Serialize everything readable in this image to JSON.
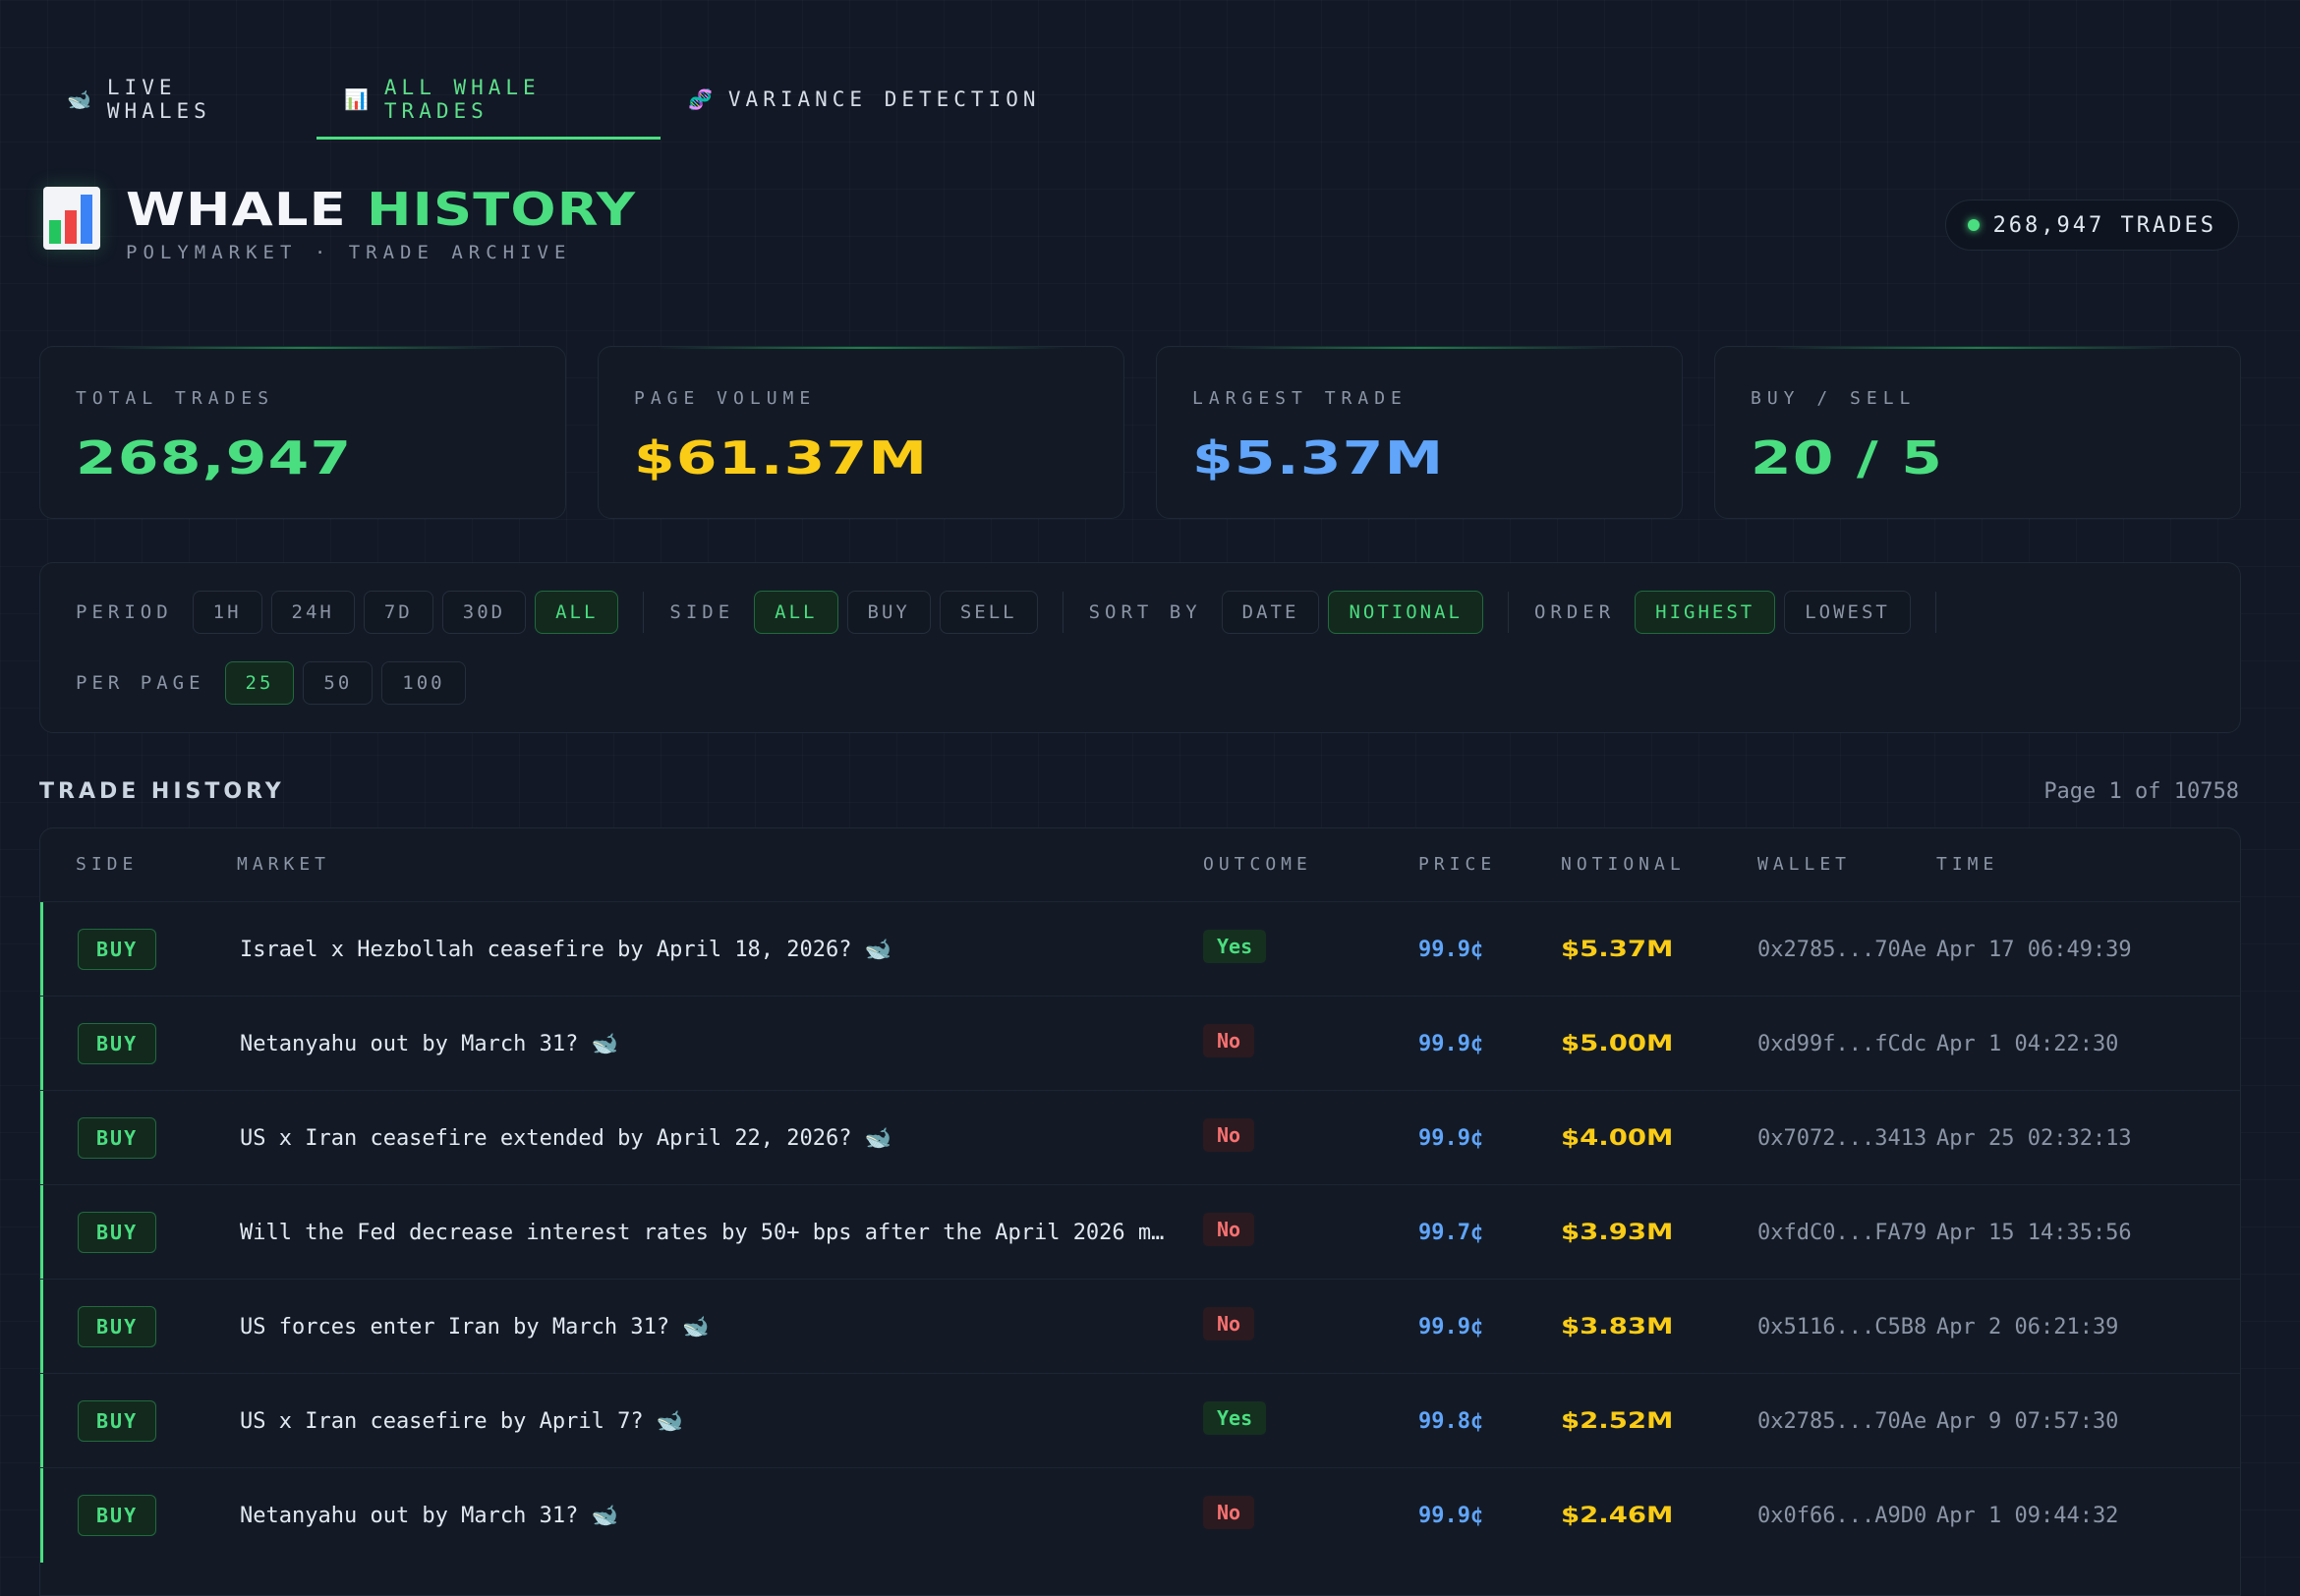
{
  "tabs": [
    {
      "icon": "🐋",
      "label": "LIVE WHALES",
      "active": false
    },
    {
      "icon": "📊",
      "label": "ALL WHALE TRADES",
      "active": true
    },
    {
      "icon": "🧬",
      "label": "VARIANCE DETECTION",
      "active": false
    }
  ],
  "header": {
    "title_white": "WHALE",
    "title_green": "HISTORY",
    "subtitle": "POLYMARKET · TRADE ARCHIVE",
    "trades_pill": "268,947 TRADES"
  },
  "stats": [
    {
      "label": "TOTAL TRADES",
      "value": "268,947",
      "color": "#4ade80"
    },
    {
      "label": "PAGE VOLUME",
      "value": "$61.37M",
      "color": "#facc15"
    },
    {
      "label": "LARGEST TRADE",
      "value": "$5.37M",
      "color": "#60a5fa"
    },
    {
      "label": "BUY / SELL",
      "value": "20 / 5",
      "color": "#4ade80"
    }
  ],
  "filters": {
    "period": {
      "label": "PERIOD",
      "options": [
        "1H",
        "24H",
        "7D",
        "30D",
        "ALL"
      ],
      "selected": "ALL"
    },
    "side": {
      "label": "SIDE",
      "options": [
        "ALL",
        "BUY",
        "SELL"
      ],
      "selected": "ALL"
    },
    "sort": {
      "label": "SORT BY",
      "options": [
        "DATE",
        "NOTIONAL"
      ],
      "selected": "NOTIONAL"
    },
    "order": {
      "label": "ORDER",
      "options": [
        "HIGHEST",
        "LOWEST"
      ],
      "selected": "HIGHEST"
    },
    "per_page": {
      "label": "PER PAGE",
      "options": [
        "25",
        "50",
        "100"
      ],
      "selected": "25"
    }
  },
  "table": {
    "title": "TRADE HISTORY",
    "page_info": "Page 1 of 10758",
    "columns": [
      "SIDE",
      "MARKET",
      "OUTCOME",
      "PRICE",
      "NOTIONAL",
      "WALLET",
      "TIME"
    ],
    "rows": [
      {
        "side": "BUY",
        "market": "Israel x Hezbollah ceasefire by April 18, 2026? 🐋",
        "outcome": "Yes",
        "price": "99.9¢",
        "notional": "$5.37M",
        "wallet": "0x2785...70Ae",
        "time": "Apr 17 06:49:39"
      },
      {
        "side": "BUY",
        "market": "Netanyahu out by March 31? 🐋",
        "outcome": "No",
        "price": "99.9¢",
        "notional": "$5.00M",
        "wallet": "0xd99f...fCdc",
        "time": "Apr 1 04:22:30"
      },
      {
        "side": "BUY",
        "market": "US x Iran ceasefire extended by April 22, 2026? 🐋",
        "outcome": "No",
        "price": "99.9¢",
        "notional": "$4.00M",
        "wallet": "0x7072...3413",
        "time": "Apr 25 02:32:13"
      },
      {
        "side": "BUY",
        "market": "Will the Fed decrease interest rates by 50+ bps after the April 2026 m…",
        "outcome": "No",
        "price": "99.7¢",
        "notional": "$3.93M",
        "wallet": "0xfdC0...FA79",
        "time": "Apr 15 14:35:56"
      },
      {
        "side": "BUY",
        "market": "US forces enter Iran by March 31? 🐋",
        "outcome": "No",
        "price": "99.9¢",
        "notional": "$3.83M",
        "wallet": "0x5116...C5B8",
        "time": "Apr 2 06:21:39"
      },
      {
        "side": "BUY",
        "market": "US x Iran ceasefire by April 7? 🐋",
        "outcome": "Yes",
        "price": "99.8¢",
        "notional": "$2.52M",
        "wallet": "0x2785...70Ae",
        "time": "Apr 9 07:57:30"
      },
      {
        "side": "BUY",
        "market": "Netanyahu out by March 31? 🐋",
        "outcome": "No",
        "price": "99.9¢",
        "notional": "$2.46M",
        "wallet": "0x0f66...A9D0",
        "time": "Apr 1 09:44:32"
      }
    ]
  }
}
